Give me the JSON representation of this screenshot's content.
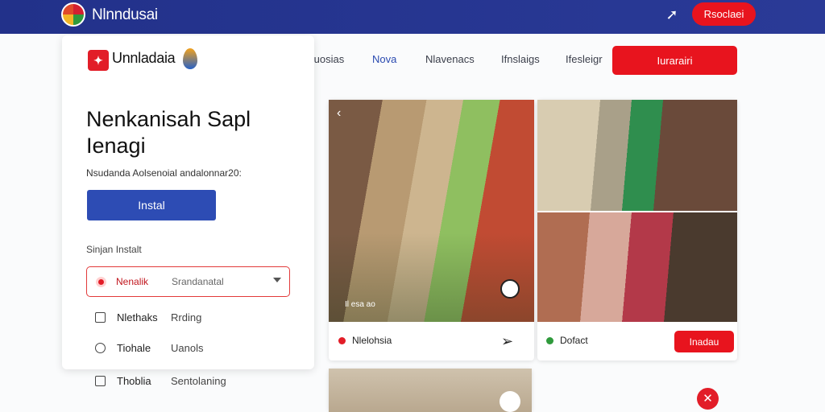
{
  "topbar": {
    "brand": "Nlnndusai",
    "cta": "Rsoclaei"
  },
  "nav": {
    "items": [
      "Iuosias",
      "Nova",
      "Nlavenacs",
      "Ifnslaigs",
      "Ifesleigr"
    ],
    "active": 1,
    "cta": "Iurarairi"
  },
  "card": {
    "brand": "Unnladaia",
    "title": "Nenkanisah Sapl Ienagi",
    "description": "Nsudanda Aolsenoial andalonnar20:",
    "install_label": "Instal",
    "section_label": "Sinjan Instalt",
    "select": {
      "value": "Nenalik",
      "alt": "Srandanatal"
    },
    "options": [
      {
        "label": "Nlethaks",
        "alt": "Rrding"
      },
      {
        "label": "Tiohale",
        "alt": "Uanols"
      },
      {
        "label": "Thoblia",
        "alt": "Sentolaning"
      }
    ]
  },
  "gallery": {
    "caption_1": "Nlelohsia",
    "caption_2": "Dofact",
    "photo_label": "Il esa ao",
    "save_label": "Inadau"
  },
  "colors": {
    "topbar": "#22318a",
    "accent": "#e8141e",
    "primary": "#2d4cb4"
  }
}
